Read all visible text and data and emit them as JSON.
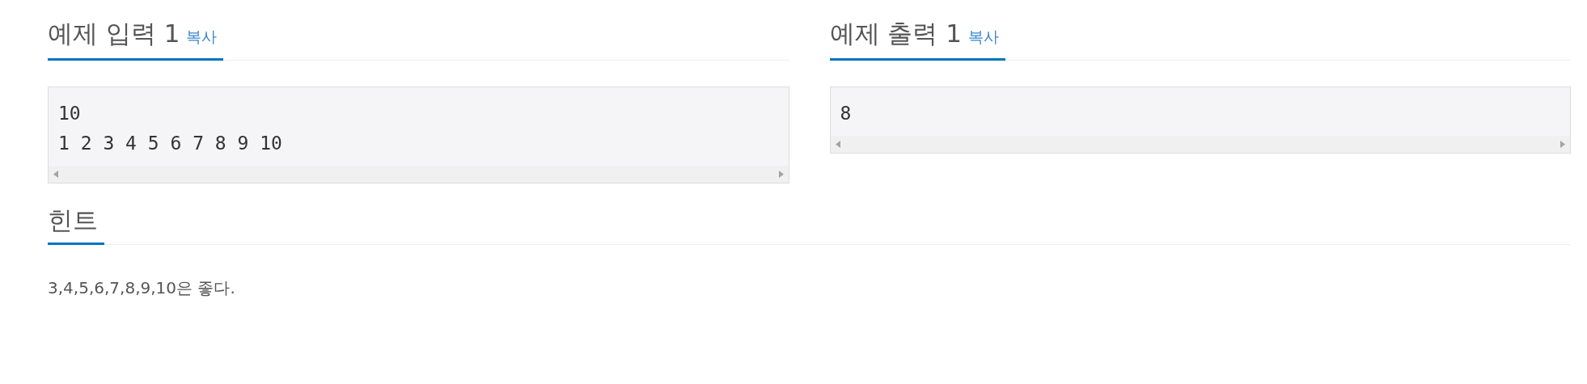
{
  "samples": [
    {
      "title": "예제 입력 1",
      "copy": "복사",
      "lines": [
        "10",
        "1 2 3 4 5 6 7 8 9 10"
      ]
    },
    {
      "title": "예제 출력 1",
      "copy": "복사",
      "lines": [
        "8"
      ]
    }
  ],
  "hint": {
    "title": "힌트",
    "text": "3,4,5,6,7,8,9,10은 좋다."
  }
}
